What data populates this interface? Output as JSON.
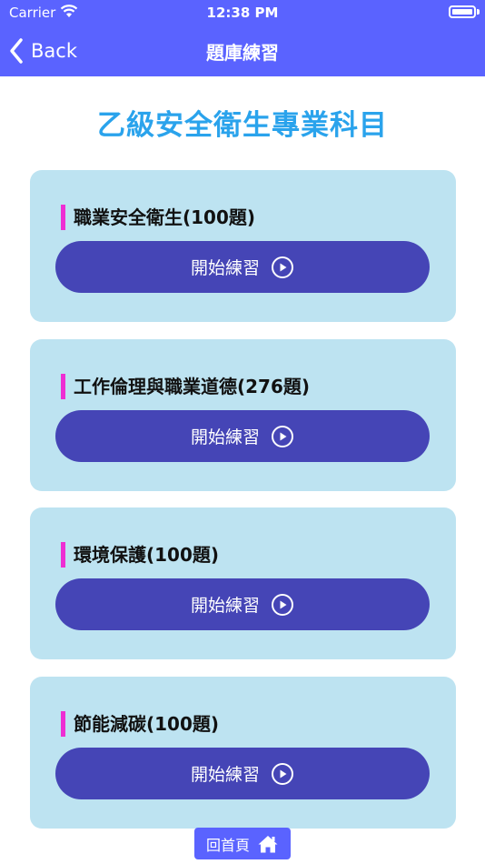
{
  "status_bar": {
    "carrier": "Carrier",
    "time": "12:38 PM"
  },
  "nav": {
    "back_label": "Back",
    "title": "題庫練習"
  },
  "heading": "乙級安全衛生專業科目",
  "cards": [
    {
      "subject": "職業安全衛生(100題)",
      "button": "開始練習"
    },
    {
      "subject": "工作倫理與職業道德(276題)",
      "button": "開始練習"
    },
    {
      "subject": "環境保護(100題)",
      "button": "開始練習"
    },
    {
      "subject": "節能減碳(100題)",
      "button": "開始練習"
    }
  ],
  "home_button": {
    "label": "回首頁",
    "icon": "home-icon"
  },
  "colors": {
    "nav": "#5a63ff",
    "heading": "#2aa3ec",
    "card_bg": "#bde3f1",
    "accent_bar": "#ee2ed3",
    "button": "#4545b6"
  }
}
